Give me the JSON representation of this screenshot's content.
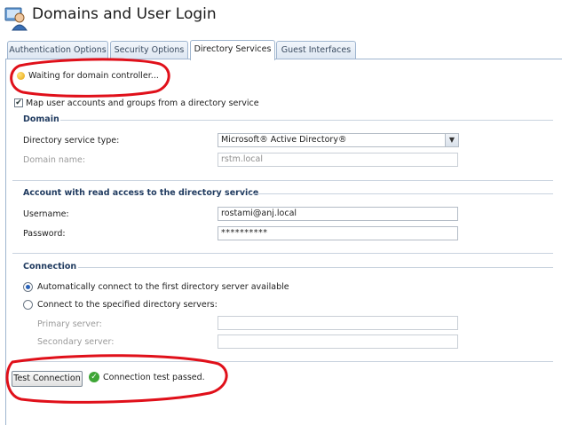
{
  "header": {
    "title": "Domains and User Login",
    "icon": "users-domain-icon"
  },
  "tabs": [
    {
      "label": "Authentication Options",
      "active": false
    },
    {
      "label": "Security Options",
      "active": false
    },
    {
      "label": "Directory Services",
      "active": true
    },
    {
      "label": "Guest Interfaces",
      "active": false
    }
  ],
  "status": {
    "text": "Waiting for domain controller...",
    "icon": "status-dot-icon",
    "color": "#f0b114"
  },
  "map_users": {
    "label": "Map user accounts and groups from a directory service",
    "checked": true
  },
  "domain": {
    "title": "Domain",
    "type_label": "Directory service type:",
    "type_value": "Microsoft® Active Directory®",
    "name_label": "Domain name:",
    "name_value": "rstm.local"
  },
  "account": {
    "title": "Account with read access to the directory service",
    "username_label": "Username:",
    "username_value": "rostami@anj.local",
    "password_label": "Password:",
    "password_value": "**********"
  },
  "connection": {
    "title": "Connection",
    "auto_label": "Automatically connect to the first directory server available",
    "auto_selected": true,
    "specified_label": "Connect to the specified directory servers:",
    "primary_label": "Primary server:",
    "secondary_label": "Secondary server:"
  },
  "test": {
    "button_label": "Test Connection",
    "result_text": "Connection test passed.",
    "result_icon": "checkmark-icon"
  },
  "colors": {
    "annotation": "#e0101a",
    "accent": "#2a62b8",
    "section_title": "#1f3a5f",
    "success": "#3fa636"
  }
}
